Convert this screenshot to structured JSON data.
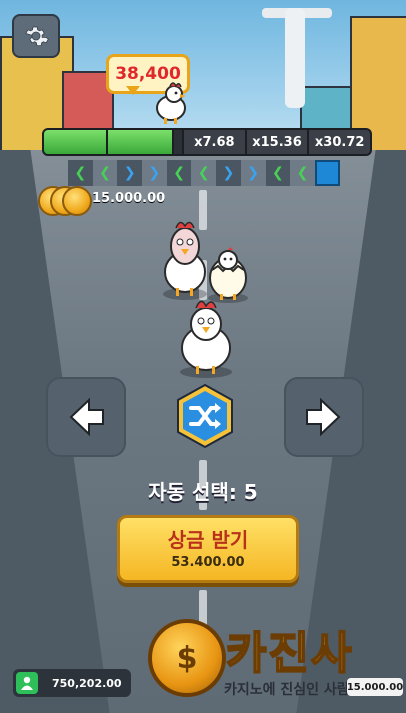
{
  "hud": {
    "prize_bubble": "38,400",
    "multipliers": [
      "x7.68",
      "x15.36",
      "x30.72"
    ],
    "coin_balance": "15.000.00"
  },
  "lane_markers": [
    "left",
    "left",
    "right",
    "right",
    "left",
    "left",
    "right",
    "right",
    "left",
    "current"
  ],
  "controls": {
    "auto_select_label": "자동 선택:",
    "auto_select_count": "5",
    "collect_label": "상금 받기",
    "collect_amount": "53.400.00"
  },
  "footer": {
    "wallet_amount": "750,202.00",
    "logo_title": "카진사",
    "logo_subtitle": "카지노에 진심인 사람들",
    "logo_amount": "15.000.00"
  },
  "colors": {
    "accent_gold": "#f5b623",
    "prize_red": "#e0272b",
    "progress_green": "#3aa83a",
    "current_blue": "#1e88d6"
  },
  "icons": [
    "gear-icon",
    "chevron-left-icon",
    "chevron-right-icon",
    "arrow-left-icon",
    "arrow-right-icon",
    "shuffle-icon",
    "user-icon",
    "coin-icon"
  ]
}
